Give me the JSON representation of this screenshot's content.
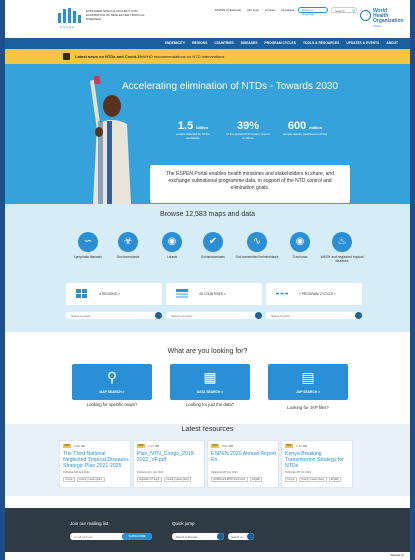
{
  "header": {
    "logo_text": "EXPANDED SPECIAL PROJECT FOR ELIMINATION OF NEGLECTED TROPICAL DISEASES",
    "logo_abbr": "ESPEN",
    "util_links": [
      "ESPEN Collaborate",
      "API login",
      "Contact",
      "Feedback"
    ],
    "lang_label": "Select a language",
    "search_placeholder": "Search",
    "who_label": "World Health Organization",
    "who_region": "Africa"
  },
  "nav": {
    "items": [
      "ENDEMICITY",
      "REGIONS",
      "COUNTRIES",
      "DISEASES",
      "PROGRAM CYCLES",
      "TOOLS & RESOURCES",
      "UPDATES & EVENTS",
      "ABOUT"
    ]
  },
  "news": {
    "label": "Latest news on NTDs and Covid-19:",
    "text": "WHO recommendations on NTD interventions"
  },
  "hero": {
    "title": "Accelerating elimination of NTDs - Towards 2030",
    "stats": [
      {
        "value": "1.5",
        "unit": "billion",
        "desc": "people affected by NTDs worldwide"
      },
      {
        "value": "39%",
        "unit": "",
        "desc": "of the global NTD burden occurs in Africa"
      },
      {
        "value": "600",
        "unit": "million",
        "desc": "people require treatment in Africa"
      }
    ],
    "description": "The ESPEN Portal enables health ministries and stakeholders to share, and exchange subnational programme data, in support of the NTD control and elimination goals."
  },
  "browse": {
    "title": "Browse 12,583 maps and data",
    "diseases": [
      "Lymphatic filariasis",
      "Onchocerciasis",
      "Loiasis",
      "Schistosomiasis",
      "Soil-transmitted helminthiasis",
      "Trachoma",
      "WASH and neglected tropical diseases"
    ],
    "cards": [
      {
        "label": "4 REGIONS >",
        "dropdown": "Select a region"
      },
      {
        "label": "48 COUNTRIES >",
        "dropdown": "Select a country"
      },
      {
        "label": "7 PROGRAM CYCLES >",
        "dropdown": "Select a cycle"
      }
    ]
  },
  "looking": {
    "title": "What are you looking for?",
    "items": [
      {
        "button": "MAP SEARCH >",
        "caption": "Looking for specific maps?"
      },
      {
        "button": "DATA SEARCH >",
        "caption": "Looking for just the data?"
      },
      {
        "button": "JAP SEARCH >",
        "caption": "Looking for JAP files?"
      }
    ]
  },
  "resources": {
    "title": "Latest resources",
    "items": [
      {
        "type": "PDF",
        "size": "3.49 MB",
        "title": "The Third National Neglected Tropical Diseases Strategic Plan 2021-2025",
        "published": "Published 28 Feb 2022",
        "tags": [
          "Kenya",
          "Country master plans"
        ]
      },
      {
        "type": "PDF",
        "size": "1.17 MB",
        "title": "Plan_NTN_Congo_2018-2022_VF.pdf",
        "published": "Published 11 Jan 2022",
        "tags": [
          "Republic of Congo",
          "Country master plans"
        ]
      },
      {
        "type": "PDF",
        "size": "5.01 MB",
        "title": "ESPEN 2020 Annual Report En",
        "published": "Published 28 Nov 2021",
        "tags": [
          "ESPEN and WHO documents",
          "English"
        ]
      },
      {
        "type": "PDF",
        "size": "7.72 MB",
        "title": "Kenya Breaking Transmission Strategy for NTDs",
        "published": "Published 05 Oct 2021",
        "tags": [
          "Kenya",
          "Country master plans",
          "English"
        ]
      }
    ]
  },
  "footer": {
    "mailing_label": "Join our mailing list",
    "email_placeholder": "email address",
    "subscribe_label": "SUBSCRIBE",
    "quick_label": "Quick jump",
    "select_disease": "Select a disease",
    "select_region": "Select a r",
    "credit": "Website by"
  },
  "colors": {
    "primary": "#2b8fd6",
    "nav": "#1a5f9e",
    "news": "#f4c542",
    "footer": "#2f3b44"
  }
}
